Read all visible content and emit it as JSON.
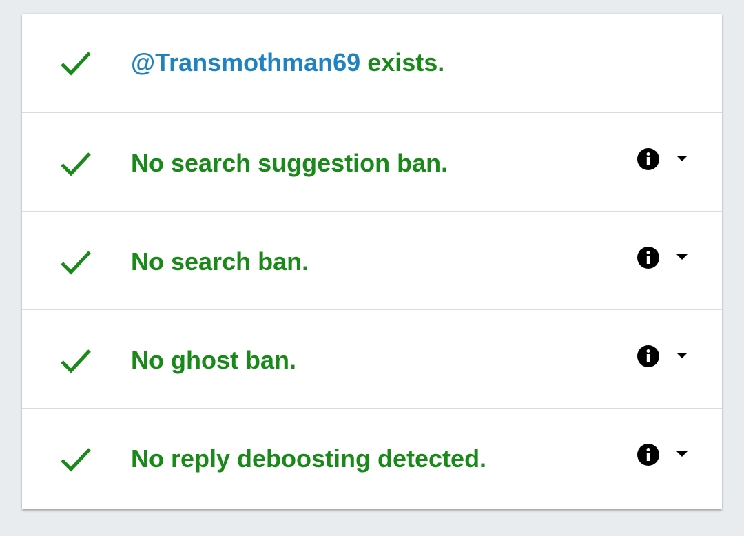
{
  "results": [
    {
      "username": "@Transmothman69",
      "text": " exists.",
      "icon": "check-icon",
      "has_info": false
    },
    {
      "text": "No search suggestion ban.",
      "icon": "check-icon",
      "has_info": true
    },
    {
      "text": "No search ban.",
      "icon": "check-icon",
      "has_info": true
    },
    {
      "text": "No ghost ban.",
      "icon": "check-icon",
      "has_info": true
    },
    {
      "text": "No reply deboosting detected.",
      "icon": "check-icon",
      "has_info": true
    }
  ],
  "colors": {
    "success": "#198a19",
    "link": "#1f83c2",
    "background": "#e8ecef"
  }
}
